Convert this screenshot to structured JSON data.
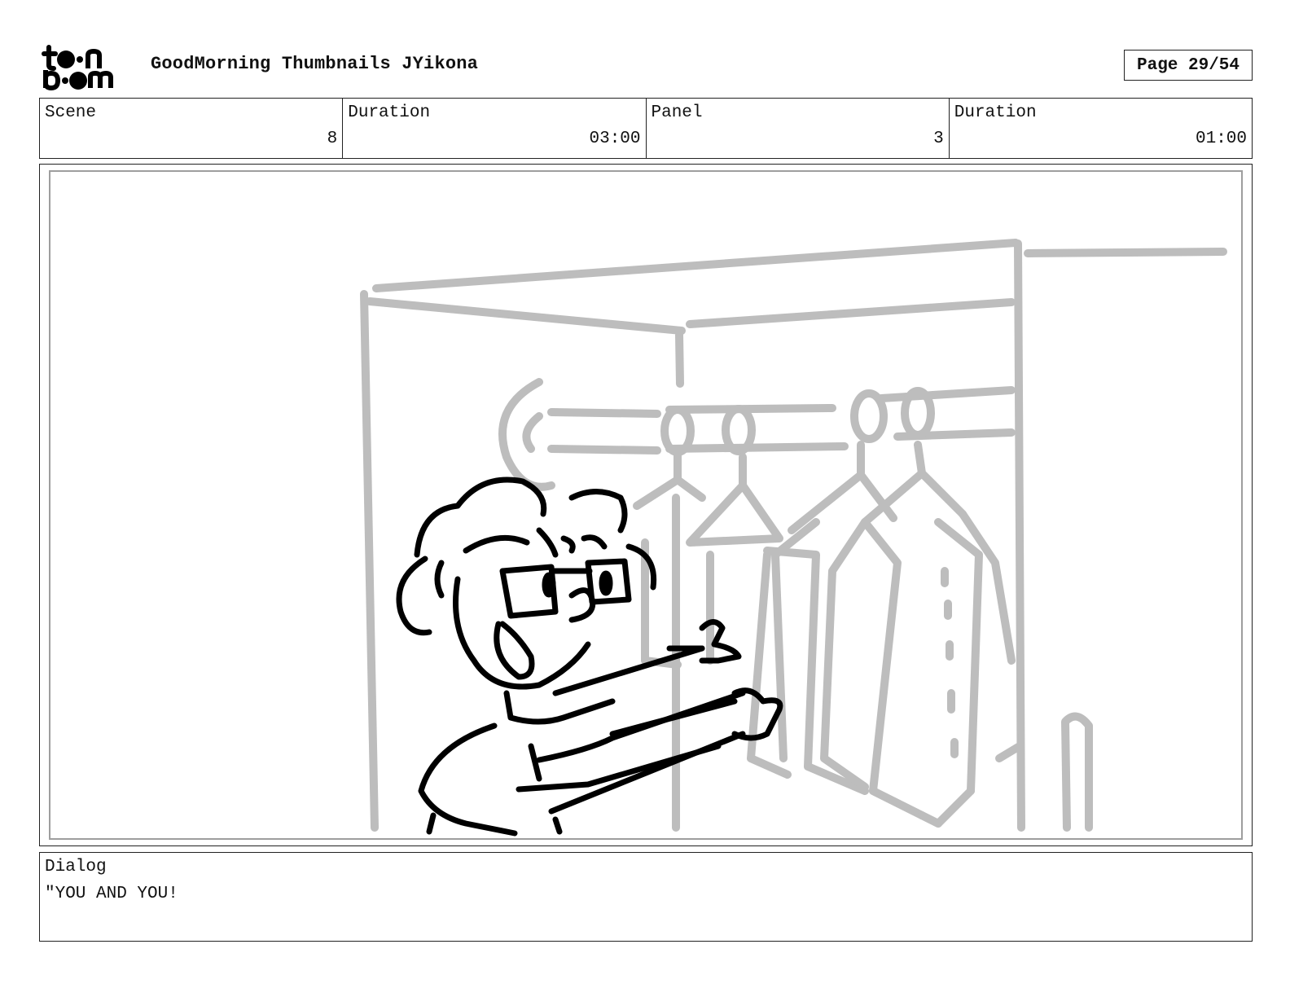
{
  "header": {
    "logo_text": "toon boom",
    "title": "GoodMorning Thumbnails JYikona",
    "page_label": "Page 29/54"
  },
  "info": {
    "scene_label": "Scene",
    "scene_value": "8",
    "scene_duration_label": "Duration",
    "scene_duration_value": "03:00",
    "panel_label": "Panel",
    "panel_value": "3",
    "panel_duration_label": "Duration",
    "panel_duration_value": "01:00"
  },
  "panel": {
    "sketch_color_background": "#bdbdbd",
    "sketch_color_character": "#000000"
  },
  "dialog": {
    "label": "Dialog",
    "text": "\"YOU AND YOU!"
  }
}
